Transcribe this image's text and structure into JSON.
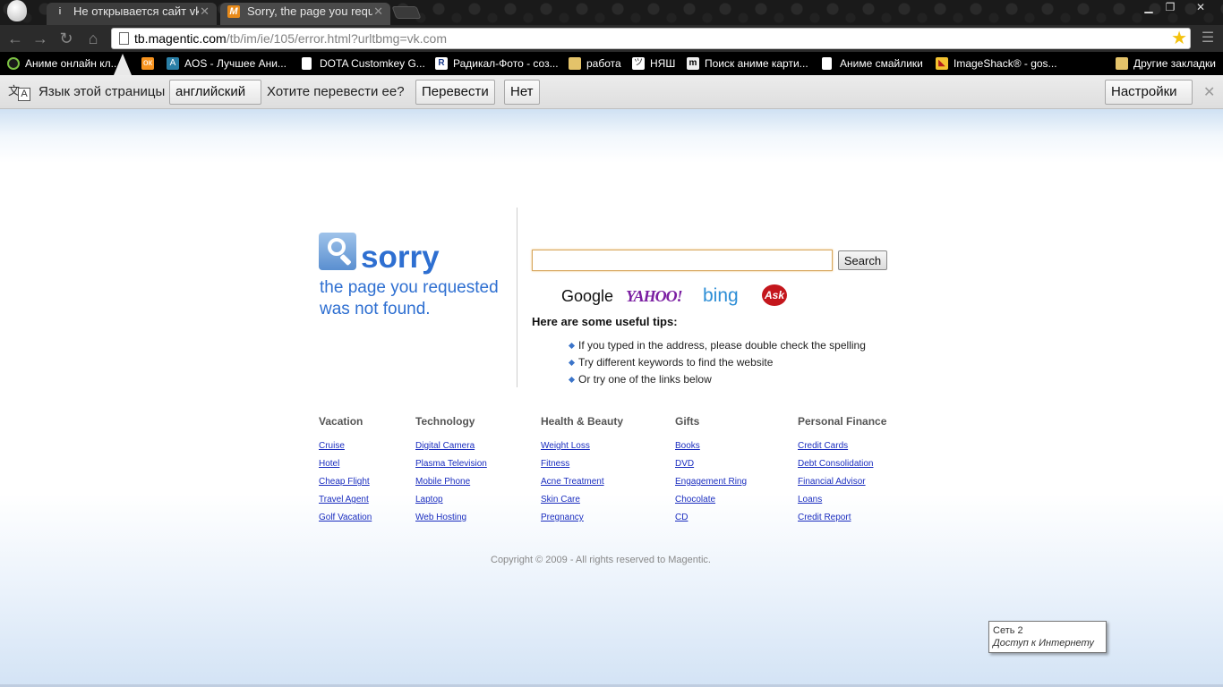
{
  "browser": {
    "tabs": [
      {
        "title": "Не открывается сайт vkon",
        "favicon": "i",
        "active": false
      },
      {
        "title": "Sorry, the page you reques",
        "favicon": "M",
        "active": true
      }
    ],
    "url_host": "tb.magentic.com",
    "url_path": "/tb/im/ie/105/error.html?urltbmg=vk.com",
    "bookmarks": [
      {
        "label": "Аниме онлайн кл...",
        "icon": "green-circle-icon"
      },
      {
        "label": "",
        "icon": "odnoklassniki-icon"
      },
      {
        "label": "AOS - Лучшее Ани...",
        "icon": "aos-icon"
      },
      {
        "label": "DOTA Customkey G...",
        "icon": "document-icon"
      },
      {
        "label": "Радикал-Фото - соз...",
        "icon": "radikal-icon"
      },
      {
        "label": "работа",
        "icon": "folder-icon"
      },
      {
        "label": "НЯШ",
        "icon": "nyash-icon"
      },
      {
        "label": "Поиск аниме карти...",
        "icon": "search-anime-icon"
      },
      {
        "label": "Аниме смайлики",
        "icon": "document-icon"
      },
      {
        "label": "ImageShack® - gos...",
        "icon": "imageshack-icon"
      }
    ],
    "other_bookmarks": "Другие закладки"
  },
  "translate_bar": {
    "prompt": "Язык этой страницы",
    "language": "английский",
    "question": "Хотите перевести ее?",
    "translate_button": "Перевести",
    "no_button": "Нет",
    "settings_button": "Настройки"
  },
  "page": {
    "sorry_title": "sorry",
    "sorry_subtitle": "the page you requested was not found.",
    "search_placeholder": "",
    "search_button": "Search",
    "engines": [
      "Google",
      "YAHOO!",
      "bing",
      "Ask"
    ],
    "tips_heading": "Here are some useful tips:",
    "tips": [
      "If you typed in the address, please double check the spelling",
      "Try different keywords to find the website",
      "Or try one of the links below"
    ],
    "categories": [
      {
        "name": "Vacation",
        "links": [
          "Cruise",
          "Hotel",
          "Cheap Flight",
          "Travel Agent",
          "Golf Vacation"
        ]
      },
      {
        "name": "Technology",
        "links": [
          "Digital Camera",
          "Plasma Television",
          "Mobile Phone",
          "Laptop",
          "Web Hosting"
        ]
      },
      {
        "name": "Health & Beauty",
        "links": [
          "Weight Loss",
          "Fitness",
          "Acne Treatment",
          "Skin Care",
          "Pregnancy"
        ]
      },
      {
        "name": "Gifts",
        "links": [
          "Books",
          "DVD",
          "Engagement Ring",
          "Chocolate",
          "CD"
        ]
      },
      {
        "name": "Personal Finance",
        "links": [
          "Credit Cards",
          "Debt Consolidation",
          "Financial Advisor",
          "Loans",
          "Credit Report"
        ]
      }
    ],
    "copyright": "Copyright © 2009 - All rights reserved to Magentic."
  },
  "tooltip": {
    "line1": "Сеть  2",
    "line2": "Доступ к Интернету"
  },
  "colors": {
    "accent": "#2e6fd1",
    "link": "#1a2dbf"
  }
}
